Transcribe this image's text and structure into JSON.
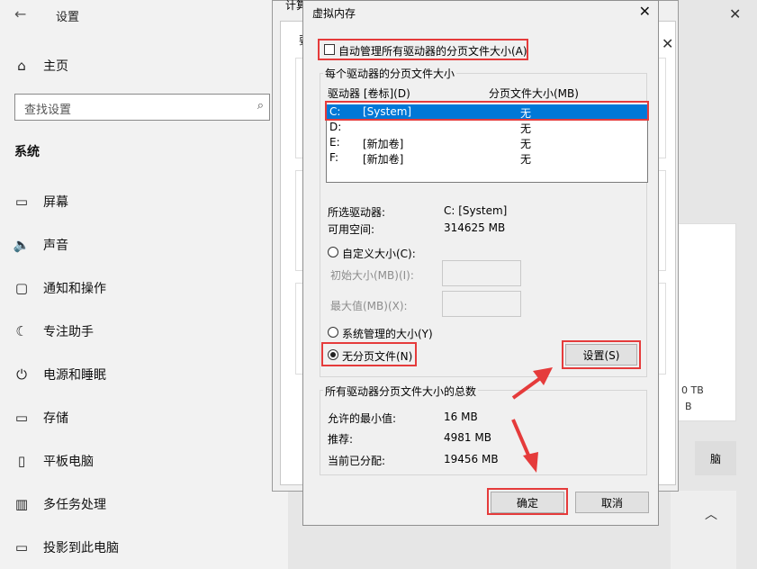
{
  "settings": {
    "title": "设置",
    "home": "主页",
    "search_placeholder": "查找设置",
    "section": "系统",
    "nav": [
      {
        "icon": "display-icon",
        "glyph": "▭",
        "label": "屏幕"
      },
      {
        "icon": "sound-icon",
        "glyph": "🔈",
        "label": "声音"
      },
      {
        "icon": "notification-icon",
        "glyph": "▢",
        "label": "通知和操作"
      },
      {
        "icon": "focus-assist-icon",
        "glyph": "☾",
        "label": "专注助手"
      },
      {
        "icon": "power-icon",
        "glyph": "⏻",
        "label": "电源和睡眠"
      },
      {
        "icon": "storage-icon",
        "glyph": "▭",
        "label": "存储"
      },
      {
        "icon": "tablet-icon",
        "glyph": "▯",
        "label": "平板电脑"
      },
      {
        "icon": "multitask-icon",
        "glyph": "▥",
        "label": "多任务处理"
      },
      {
        "icon": "project-icon",
        "glyph": "▭",
        "label": "投影到此电脑"
      }
    ],
    "right_partial": {
      "tb_text": "0 TB",
      "b_text": "B",
      "btn_text": "脑"
    }
  },
  "behind_window": {
    "title_partial": "计算",
    "label_partial": "要"
  },
  "dialog": {
    "title": "虚拟内存",
    "auto_manage": "自动管理所有驱动器的分页文件大小(A)",
    "group_title": "每个驱动器的分页文件大小",
    "col_drive": "驱动器 [卷标](D)",
    "col_size": "分页文件大小(MB)",
    "drives": [
      {
        "drive": "C:",
        "label": "[System]",
        "size": "无",
        "selected": true
      },
      {
        "drive": "D:",
        "label": "",
        "size": "无",
        "selected": false
      },
      {
        "drive": "E:",
        "label": "[新加卷]",
        "size": "无",
        "selected": false
      },
      {
        "drive": "F:",
        "label": "[新加卷]",
        "size": "无",
        "selected": false
      }
    ],
    "selected_drive_label": "所选驱动器:",
    "selected_drive_value": "C:  [System]",
    "free_space_label": "可用空间:",
    "free_space_value": "314625 MB",
    "custom_size": "自定义大小(C):",
    "initial_size": "初始大小(MB)(I):",
    "max_size": "最大值(MB)(X):",
    "system_managed": "系统管理的大小(Y)",
    "no_paging": "无分页文件(N)",
    "set_button": "设置(S)",
    "totals_title": "所有驱动器分页文件大小的总数",
    "min_allowed_label": "允许的最小值:",
    "min_allowed_value": "16 MB",
    "recommended_label": "推荐:",
    "recommended_value": "4981 MB",
    "allocated_label": "当前已分配:",
    "allocated_value": "19456 MB",
    "ok_button": "确定",
    "cancel_button": "取消"
  },
  "colors": {
    "highlight": "#0078d7",
    "annotation": "#e53b3b"
  }
}
